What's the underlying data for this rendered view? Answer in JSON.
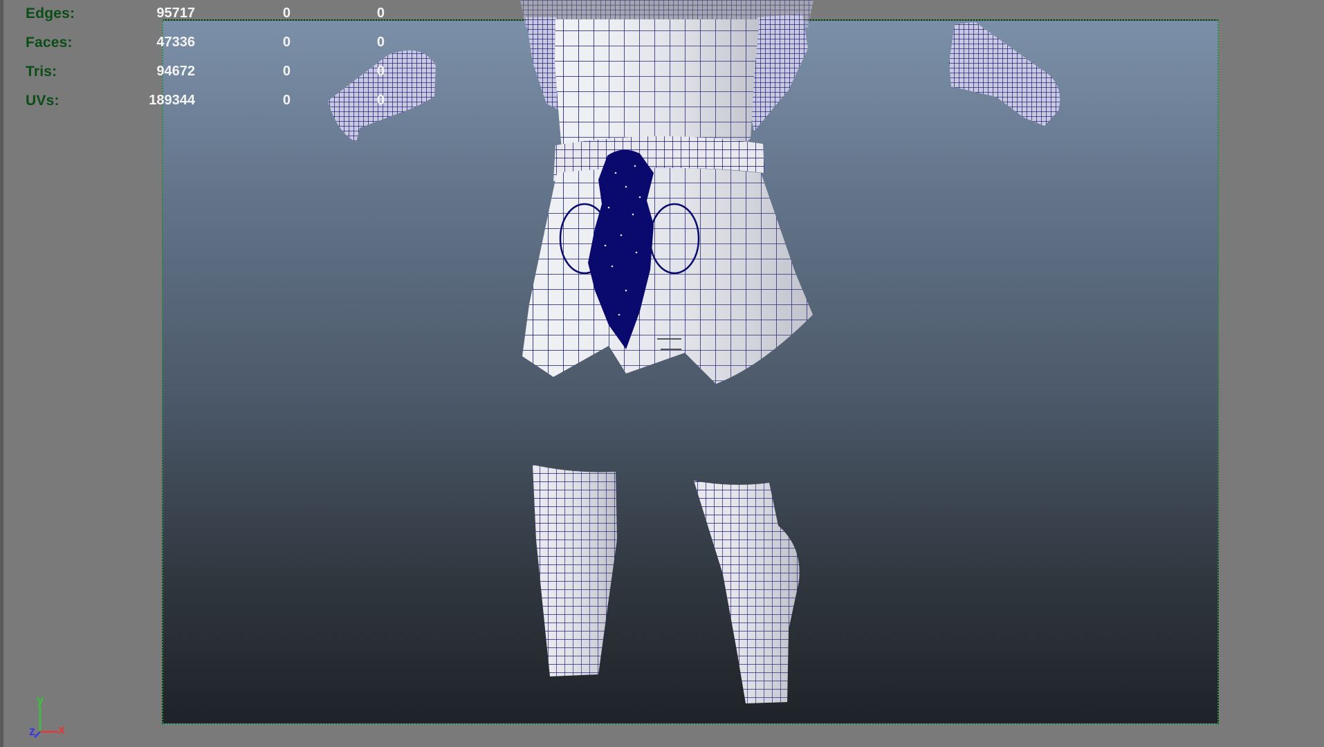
{
  "hud": {
    "rows": [
      {
        "label": "Edges:",
        "total": "95717",
        "selected": "0",
        "extra": "0"
      },
      {
        "label": "Faces:",
        "total": "47336",
        "selected": "0",
        "extra": "0"
      },
      {
        "label": "Tris:",
        "total": "94672",
        "selected": "0",
        "extra": "0"
      },
      {
        "label": "UVs:",
        "total": "189344",
        "selected": "0",
        "extra": "0"
      }
    ]
  },
  "axis": {
    "y_label": "y",
    "z_label": "z",
    "x_label": "x",
    "y_color": "#3ac23a",
    "z_color": "#3a3ae0",
    "x_color": "#e03a3a"
  },
  "colors": {
    "label_green": "#0b4d17",
    "value_white": "#f4f4f4",
    "gate_border": "#2e8a3e",
    "wire_blue": "#0a0a6e",
    "mesh_white": "#e8e8ec"
  }
}
